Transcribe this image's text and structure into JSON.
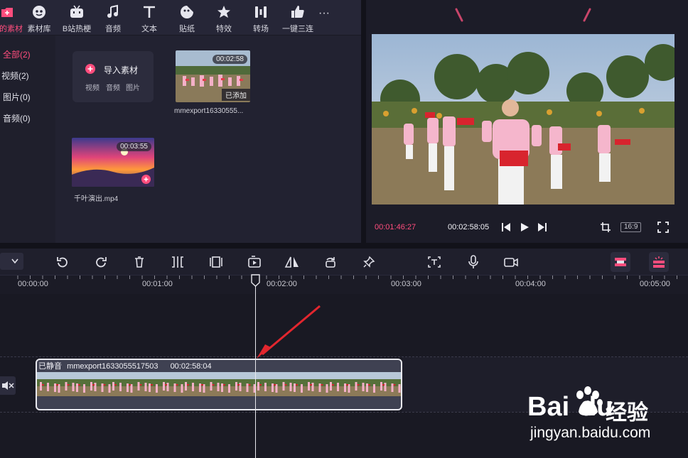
{
  "toolbar": {
    "items": [
      {
        "label": "我的素材",
        "icon": "media-icon",
        "active": true
      },
      {
        "label": "素材库",
        "icon": "library-icon"
      },
      {
        "label": "B站热梗",
        "icon": "bilibili-icon"
      },
      {
        "label": "音频",
        "icon": "music-note-icon"
      },
      {
        "label": "文本",
        "icon": "text-icon"
      },
      {
        "label": "贴纸",
        "icon": "sticker-icon"
      },
      {
        "label": "特效",
        "icon": "effect-star-icon"
      },
      {
        "label": "转场",
        "icon": "transition-icon"
      },
      {
        "label": "一键三连",
        "icon": "thumbs-up-icon"
      }
    ],
    "more": "···"
  },
  "categories": [
    {
      "label": "全部(2)",
      "active": true
    },
    {
      "label": "视频(2)"
    },
    {
      "label": "图片(0)"
    },
    {
      "label": "音频(0)"
    }
  ],
  "import_card": {
    "title": "导入素材",
    "types": [
      "视频",
      "音频",
      "图片"
    ]
  },
  "media": [
    {
      "duration": "00:02:58",
      "badge": "已添加",
      "name": "mmexport16330555..."
    },
    {
      "duration": "00:03:55",
      "name": "千叶演出.mp4"
    }
  ],
  "player": {
    "current_time": "00:01:46:27",
    "total_time": "00:02:58:05",
    "ratio": "16:9"
  },
  "ruler": {
    "labels": [
      "00:00:00",
      "00:01:00",
      "00:02:00",
      "00:03:00",
      "00:04:00",
      "00:05:00"
    ]
  },
  "clip": {
    "muted_label": "已静音",
    "name": "mmexport1633055517503",
    "duration": "00:02:58:04"
  },
  "watermark": {
    "brand": "Bai",
    "brand2": "du",
    "cn": "经验",
    "url": "jingyan.baidu.com"
  },
  "colors": {
    "accent": "#ff4d7d",
    "panel": "#222231",
    "background": "#1b1b26"
  }
}
